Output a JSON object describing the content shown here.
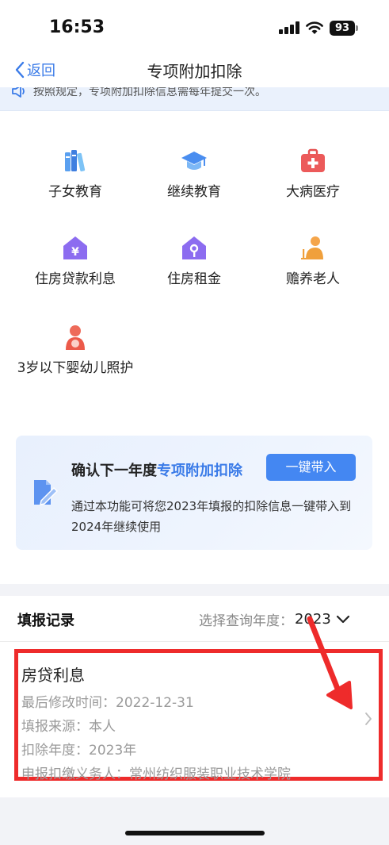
{
  "status_bar": {
    "time": "16:53",
    "battery": "93"
  },
  "nav": {
    "back_label": "返回",
    "title": "专项附加扣除"
  },
  "notice": {
    "text": "按照规定，专项附加扣除信息需每年提交一次。"
  },
  "categories": [
    {
      "label": "子女教育",
      "icon": "books-icon"
    },
    {
      "label": "继续教育",
      "icon": "graduation-cap-icon"
    },
    {
      "label": "大病医疗",
      "icon": "medical-kit-icon"
    },
    {
      "label": "住房贷款利息",
      "icon": "house-yuan-icon"
    },
    {
      "label": "住房租金",
      "icon": "house-key-icon"
    },
    {
      "label": "赡养老人",
      "icon": "elder-person-icon"
    },
    {
      "label": "3岁以下婴幼儿照护",
      "icon": "mother-baby-icon"
    }
  ],
  "carry_forward": {
    "title_prefix": "确认下一年度",
    "title_highlight": "专项附加扣除",
    "button_label": "一键带入",
    "description": "通过本功能可将您2023年填报的扣除信息一键带入到2024年继续使用",
    "icon": "document-pen-icon"
  },
  "records": {
    "title": "填报记录",
    "year_select_label": "选择查询年度：",
    "year_value": "2023",
    "items": [
      {
        "title": "房贷利息",
        "modified": "最后修改时间：2022-12-31",
        "source": "填报来源：本人",
        "deduct_year": "扣除年度：2023年",
        "withholder": "申报扣缴义务人：常州纺织服装职业技术学院"
      }
    ]
  },
  "colors": {
    "accent": "#3a7be8",
    "button": "#4487f2",
    "annotation": "#ee2b2b"
  }
}
